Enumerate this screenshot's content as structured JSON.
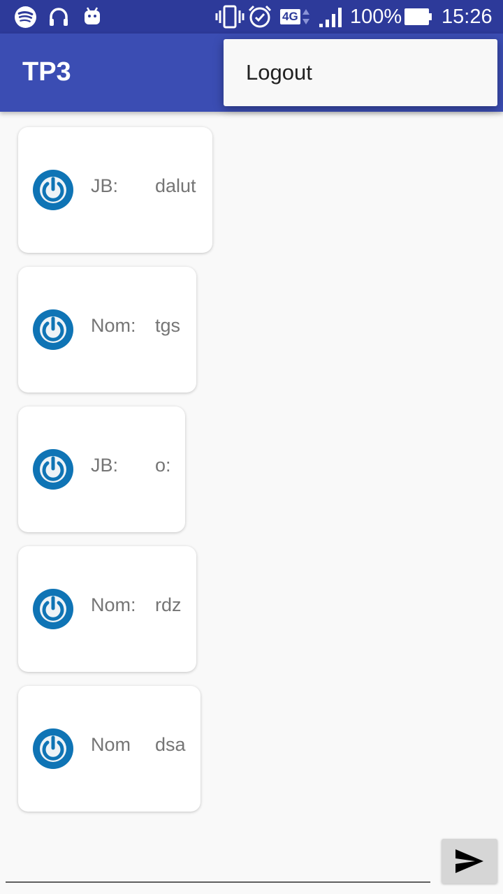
{
  "status_bar": {
    "left_icons": [
      "spotify-icon",
      "headphones-icon",
      "android-icon"
    ],
    "right_icons": [
      "vibrate-icon",
      "alarm-icon",
      "network-4g-icon",
      "signal-icon",
      "battery-icon"
    ],
    "network_label": "4G",
    "battery": "100%",
    "time": "15:26"
  },
  "app_bar": {
    "title": "TP3"
  },
  "overflow_menu": {
    "items": [
      {
        "label": "Logout"
      }
    ]
  },
  "messages": [
    {
      "name": "JB:",
      "message": "dalut"
    },
    {
      "name": "Nom:",
      "message": "tgs"
    },
    {
      "name": "JB:",
      "message": "o:"
    },
    {
      "name": "Nom:",
      "message": "rdz"
    },
    {
      "name": "Nom",
      "message": "dsa"
    }
  ],
  "composer": {
    "input_value": "",
    "send_icon": "send-icon"
  },
  "colors": {
    "status_bar": "#2d3a9a",
    "app_bar": "#3b4db3",
    "background": "#f9f9f9",
    "avatar_blue": "#0f74b5",
    "text_gray": "#757575"
  }
}
